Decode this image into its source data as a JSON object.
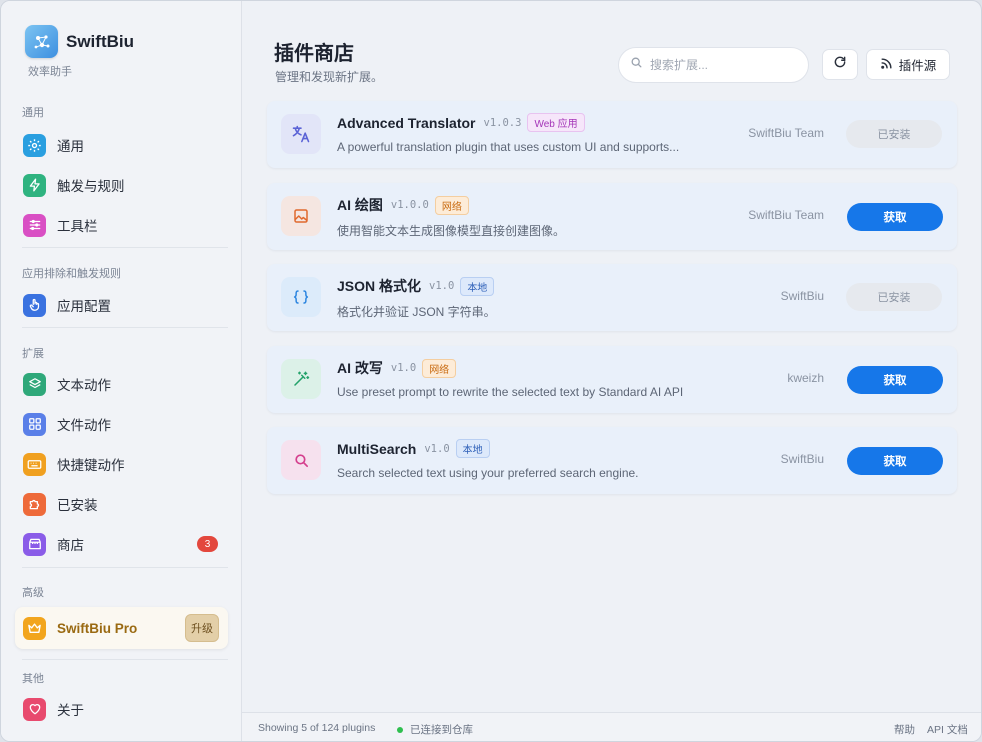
{
  "app": {
    "name": "SwiftBiu",
    "subtitle": "效率助手"
  },
  "sidebar": {
    "sections": {
      "general": "通用",
      "app_rules": "应用排除和触发规则",
      "extensions": "扩展",
      "advanced": "高级",
      "other": "其他"
    },
    "items": {
      "general": {
        "label": "通用",
        "icon": "gear-icon",
        "color": "#2a9fe0"
      },
      "triggers": {
        "label": "触发与规则",
        "icon": "bolt-icon",
        "color": "#2fb380"
      },
      "toolbar": {
        "label": "工具栏",
        "icon": "sliders-icon",
        "color": "#d94fc4"
      },
      "app_config": {
        "label": "应用配置",
        "icon": "hand-pointer-icon",
        "color": "#3a72e0"
      },
      "text_actions": {
        "label": "文本动作",
        "icon": "layers-icon",
        "color": "#2fa87a"
      },
      "file_actions": {
        "label": "文件动作",
        "icon": "grid-icon",
        "color": "#5a7fe8"
      },
      "shortcut_actions": {
        "label": "快捷键动作",
        "icon": "keyboard-icon",
        "color": "#f0a020"
      },
      "installed": {
        "label": "已安装",
        "icon": "puzzle-icon",
        "color": "#ee6a3a"
      },
      "store": {
        "label": "商店",
        "icon": "store-icon",
        "color": "#8a5ce8",
        "badge": "3"
      },
      "about": {
        "label": "关于",
        "icon": "heart-icon",
        "color": "#e84a6e"
      }
    },
    "pro": {
      "label": "SwiftBiu Pro",
      "upgrade": "升级",
      "icon": "crown-icon"
    }
  },
  "main": {
    "title": "插件商店",
    "subtitle": "管理和发现新扩展。",
    "search_placeholder": "搜索扩展...",
    "source_button": "插件源"
  },
  "plugins": [
    {
      "name": "Advanced Translator",
      "version": "v1.0.3",
      "tag": "Web 应用",
      "tag_style": "web",
      "description": "A powerful translation plugin that uses custom UI and supports...",
      "author": "SwiftBiu Team",
      "action": "已安装",
      "installed": true,
      "icon": "translate-icon"
    },
    {
      "name": "AI 绘图",
      "version": "v1.0.0",
      "tag": "网络",
      "tag_style": "net",
      "description": "使用智能文本生成图像模型直接创建图像。",
      "author": "SwiftBiu Team",
      "action": "获取",
      "installed": false,
      "icon": "image-icon"
    },
    {
      "name": "JSON 格式化",
      "version": "v1.0",
      "tag": "本地",
      "tag_style": "local",
      "description": "格式化并验证 JSON 字符串。",
      "author": "SwiftBiu",
      "action": "已安装",
      "installed": true,
      "icon": "braces-icon"
    },
    {
      "name": "AI 改写",
      "version": "v1.0",
      "tag": "网络",
      "tag_style": "net",
      "description": "Use preset prompt to rewrite the selected text by Standard AI API",
      "author": "kweizh",
      "action": "获取",
      "installed": false,
      "icon": "magic-wand-icon"
    },
    {
      "name": "MultiSearch",
      "version": "v1.0",
      "tag": "本地",
      "tag_style": "local",
      "description": "Search selected text using your preferred search engine.",
      "author": "SwiftBiu",
      "action": "获取",
      "installed": false,
      "icon": "search-icon"
    }
  ],
  "footer": {
    "count": "Showing 5 of 124 plugins",
    "status": "已连接到仓库",
    "help": "帮助",
    "api_docs": "API 文档"
  }
}
